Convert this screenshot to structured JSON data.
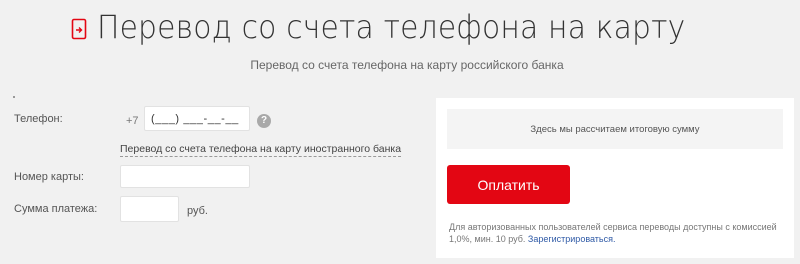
{
  "header": {
    "title": "Перевод со счета телефона на карту",
    "subtitle": "Перевод со счета телефона на карту российского банка",
    "icon": "phone-transfer-icon",
    "accent_color": "#e30613"
  },
  "form": {
    "phone_label": "Телефон:",
    "phone_prefix": "+7",
    "phone_mask": "(___) ___-__-__",
    "help_glyph": "?",
    "foreign_link": "Перевод со счета телефона на карту иностранного банка",
    "card_label": "Номер карты:",
    "card_value": "",
    "amount_label": "Сумма платежа:",
    "amount_value": "",
    "currency": "руб."
  },
  "summary": {
    "placeholder": "Здесь мы рассчитаем итоговую сумму",
    "pay_button": "Оплатить",
    "note_text": "Для авторизованных пользователей сервиса переводы доступны с комиссией 1,0%, мин. 10 руб.",
    "register_link": "Зарегистрироваться."
  }
}
